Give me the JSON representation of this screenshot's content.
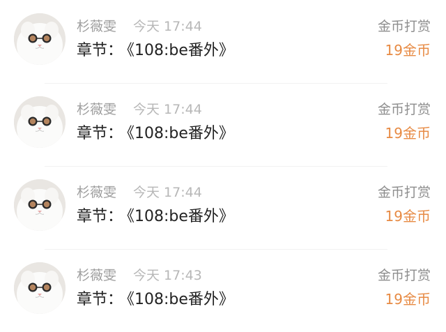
{
  "colors": {
    "accent": "#e78a43",
    "name_gray": "#9d9d9d",
    "time_gray": "#b7b7b7",
    "text": "#222222"
  },
  "gifts": [
    {
      "user": "杉薇雯",
      "time": "今天 17:44",
      "chapter_label": "章节：",
      "chapter_title": "《108:be番外》",
      "gift_type": "金币打赏",
      "amount": "19金币",
      "avatar_icon": "white-cat-sunglasses-avatar"
    },
    {
      "user": "杉薇雯",
      "time": "今天 17:44",
      "chapter_label": "章节：",
      "chapter_title": "《108:be番外》",
      "gift_type": "金币打赏",
      "amount": "19金币",
      "avatar_icon": "white-cat-sunglasses-avatar"
    },
    {
      "user": "杉薇雯",
      "time": "今天 17:44",
      "chapter_label": "章节：",
      "chapter_title": "《108:be番外》",
      "gift_type": "金币打赏",
      "amount": "19金币",
      "avatar_icon": "white-cat-sunglasses-avatar"
    },
    {
      "user": "杉薇雯",
      "time": "今天 17:43",
      "chapter_label": "章节：",
      "chapter_title": "《108:be番外》",
      "gift_type": "金币打赏",
      "amount": "19金币",
      "avatar_icon": "white-cat-sunglasses-avatar"
    }
  ]
}
